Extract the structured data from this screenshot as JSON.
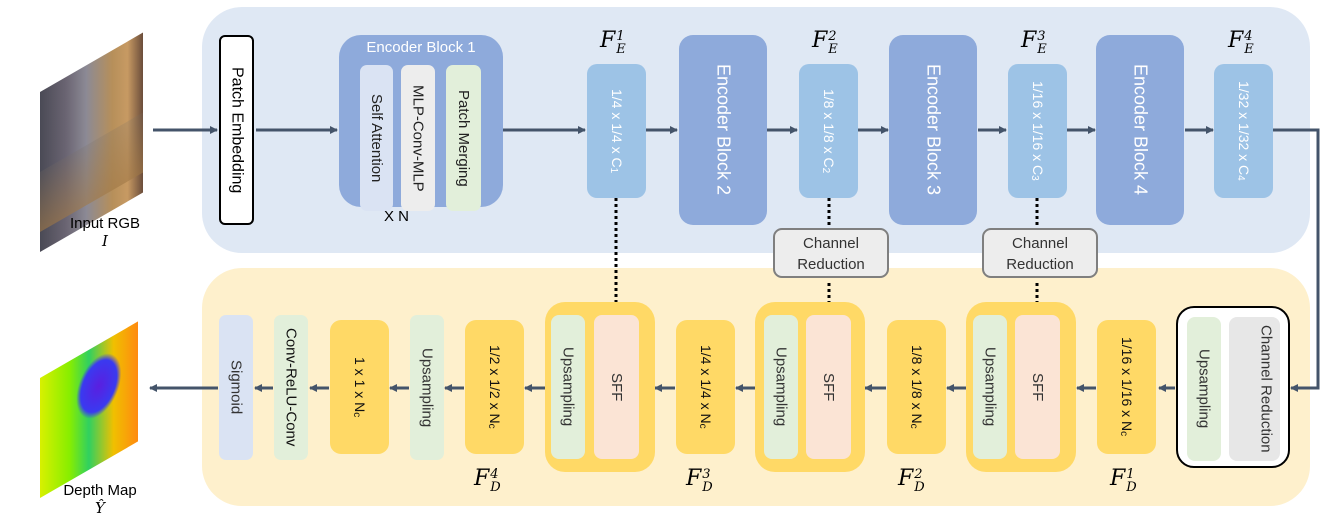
{
  "input": {
    "caption": "Input RGB",
    "symbol": "I"
  },
  "output": {
    "caption": "Depth Map",
    "symbol": "Ŷ"
  },
  "encoder": {
    "patch_embedding": "Patch Embedding",
    "block1": {
      "title": "Encoder Block 1",
      "sub": [
        "Self Attention",
        "MLP-Conv-MLP",
        "Patch Merging"
      ],
      "repeat": "X N"
    },
    "blocks": [
      "Encoder Block 2",
      "Encoder Block 3",
      "Encoder Block 4"
    ],
    "features": [
      {
        "label_base": "F",
        "label_sub": "E",
        "label_sup": "1",
        "dims": "1/4 x 1/4 x C",
        "dims_sub": "1"
      },
      {
        "label_base": "F",
        "label_sub": "E",
        "label_sup": "2",
        "dims": "1/8 x 1/8 x C",
        "dims_sub": "2"
      },
      {
        "label_base": "F",
        "label_sub": "E",
        "label_sup": "3",
        "dims": "1/16 x 1/16 x C",
        "dims_sub": "3"
      },
      {
        "label_base": "F",
        "label_sub": "E",
        "label_sup": "4",
        "dims": "1/32 x 1/32 x C",
        "dims_sub": "4"
      }
    ],
    "channel_reduction": "Channel\nReduction"
  },
  "decoder": {
    "head": {
      "upsampling": "Upsampling",
      "channel_reduction": "Channel Reduction"
    },
    "features": [
      {
        "label_base": "F",
        "label_sub": "D",
        "label_sup": "1",
        "dims": "1/16 x 1/16 x N",
        "dims_sub": "c"
      },
      {
        "label_base": "F",
        "label_sub": "D",
        "label_sup": "2",
        "dims": "1/8 x 1/8 x N",
        "dims_sub": "c"
      },
      {
        "label_base": "F",
        "label_sub": "D",
        "label_sup": "3",
        "dims": "1/4 x 1/4 x N",
        "dims_sub": "c"
      },
      {
        "label_base": "F",
        "label_sub": "D",
        "label_sup": "4",
        "dims": "1/2 x 1/2 x N",
        "dims_sub": "c"
      }
    ],
    "sff_label": "SFF",
    "upsampling_label": "Upsampling",
    "final_feature": {
      "dims": "1 x 1 x N",
      "dims_sub": "c"
    },
    "conv_relu_conv": "Conv-ReLU-Conv",
    "sigmoid": "Sigmoid"
  },
  "colors": {
    "encoder_panel": "#dfe8f4",
    "decoder_panel": "#fef0cc",
    "encoder_block": "#8eaadb",
    "encoder_feature": "#9dc3e6",
    "decoder_feature": "#ffd966",
    "upsampling": "#e2efda",
    "sff": "#fbe4d5",
    "sigmoid": "#dae3f3",
    "channel_reduction": "#ededed",
    "arrow": "#44546a"
  }
}
